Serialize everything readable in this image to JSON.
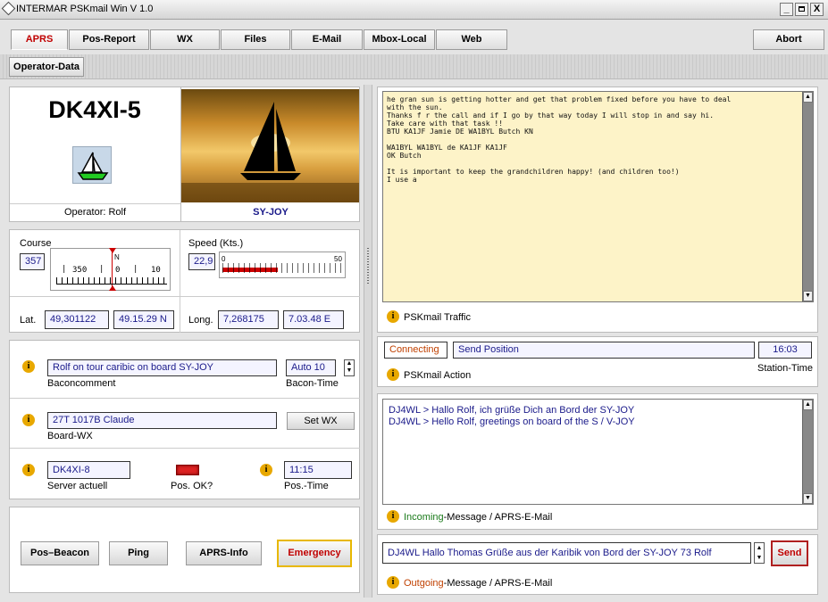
{
  "window": {
    "title": "INTERMAR PSKmail Win V 1.0",
    "min": "_",
    "max": " ",
    "close": "X"
  },
  "tabs": [
    "APRS",
    "Pos-Report",
    "WX",
    "Files",
    "E-Mail",
    "Mbox-Local",
    "Web"
  ],
  "abort": "Abort",
  "operator_data": "Operator-Data",
  "station": {
    "callsign": "DK4XI-5",
    "operator": "Operator: Rolf",
    "boat": "SY-JOY"
  },
  "course": {
    "label": "Course",
    "value": "357",
    "scale_n": "N",
    "scale_350": "350",
    "scale_0": "0",
    "scale_10": "10"
  },
  "speed": {
    "label": "Speed (Kts.)",
    "value": "22,9",
    "min": "0",
    "max": "50"
  },
  "position": {
    "lat_label": "Lat.",
    "lat_dec": "49,301122",
    "lat_dm": "49.15.29 N",
    "long_label": "Long.",
    "long_dec": "7,268175",
    "long_dm": "7.03.48 E"
  },
  "baconcomment": {
    "value": "Rolf on tour caribic on board SY-JOY",
    "label": "Baconcomment",
    "time_value": "Auto 10",
    "time_label": "Bacon-Time"
  },
  "boardwx": {
    "value": "27T 1017B Claude",
    "label": "Board-WX",
    "button": "Set WX"
  },
  "server": {
    "value": "DK4XI-8",
    "label": "Server actuell",
    "pos_ok": "Pos. OK?",
    "pos_time": "11:15",
    "pos_time_label": "Pos.-Time"
  },
  "actions": {
    "beacon": "Pos–Beacon",
    "ping": "Ping",
    "info": "APRS-Info",
    "emergency": "Emergency"
  },
  "traffic": {
    "text": "he gran sun is getting hotter and get that problem fixed before you have to deal\nwith the sun.\nThanks f r the call and if I go by that way today I will stop in and say hi.\nTake care with that task !!\nBTU KA1JF Jamie DE WA1BYL Butch KN\n\nWA1BYL WA1BYL de KA1JF KA1JF\nOK Butch\n\nIt is important to keep the grandchildren happy! (and children too!)\nI use a",
    "label": "PSKmail Traffic"
  },
  "action": {
    "status": "Connecting",
    "command": "Send Position",
    "time": "16:03",
    "time_label": "Station-Time",
    "label": "PSKmail Action"
  },
  "incoming": {
    "lines": [
      "DJ4WL > Hallo Rolf, ich grüße Dich an Bord der SY-JOY",
      "DJ4WL > Hello Rolf, greetings on board of the S / V-JOY"
    ],
    "label_a": "Incoming",
    "label_b": "-Message / APRS-E-Mail"
  },
  "outgoing": {
    "value": "DJ4WL  Hallo Thomas Grüße aus der Karibik von Bord der SY-JOY 73 Rolf",
    "send": "Send",
    "label_a": "Outgoing",
    "label_b": "-Message / APRS-E-Mail"
  },
  "colors": {
    "accent": "#c00000",
    "field_text": "#1a1a8a",
    "incoming": "#1a7a1a",
    "outgoing": "#c04000"
  }
}
